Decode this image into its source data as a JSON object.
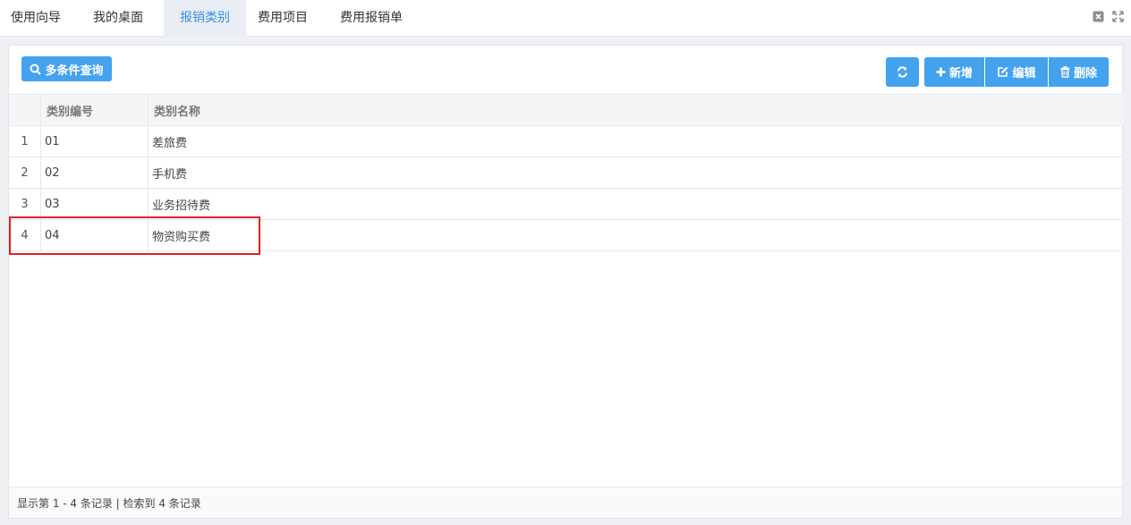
{
  "tabs": [
    {
      "label": "使用向导",
      "active": false
    },
    {
      "label": "我的桌面",
      "active": false
    },
    {
      "label": "报销类别",
      "active": true
    },
    {
      "label": "费用项目",
      "active": false
    },
    {
      "label": "费用报销单",
      "active": false
    }
  ],
  "toolbar": {
    "search_label": "多条件查询",
    "add_label": "新增",
    "edit_label": "编辑",
    "delete_label": "删除"
  },
  "table": {
    "columns": [
      "类别编号",
      "类别名称"
    ],
    "rows": [
      {
        "index": "1",
        "code": "01",
        "name": "差旅费"
      },
      {
        "index": "2",
        "code": "02",
        "name": "手机费"
      },
      {
        "index": "3",
        "code": "03",
        "name": "业务招待费"
      },
      {
        "index": "4",
        "code": "04",
        "name": "物资购买费"
      }
    ]
  },
  "footer": {
    "status": "显示第 1 - 4 条记录 | 检索到 4 条记录"
  },
  "colors": {
    "accent": "#44a2ef",
    "active_tab_text": "#3a8ee6",
    "highlight": "#e02020"
  }
}
